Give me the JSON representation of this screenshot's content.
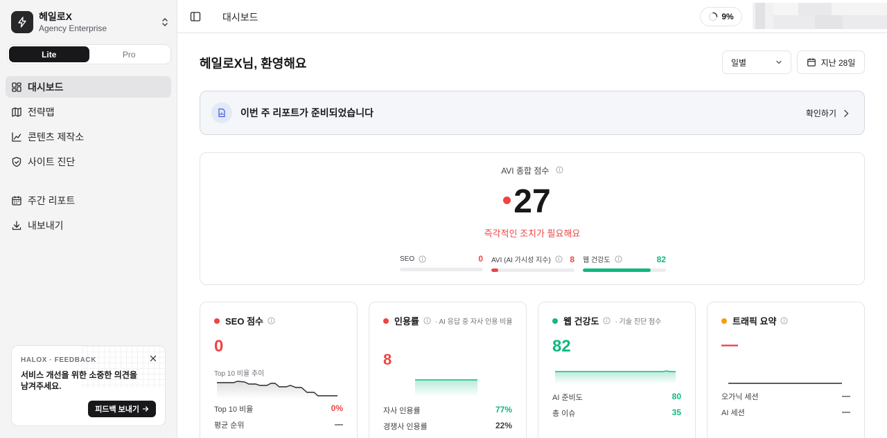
{
  "org": {
    "name": "헤일로X",
    "plan": "Agency Enterprise"
  },
  "plan_toggle": {
    "options": [
      "Lite",
      "Pro"
    ],
    "selected": "Lite"
  },
  "sidebar": {
    "items": [
      {
        "label": "대시보드",
        "icon": "dashboard-icon",
        "active": true
      },
      {
        "label": "전략맵",
        "icon": "map-icon"
      },
      {
        "label": "콘텐츠 제작소",
        "icon": "chart-icon"
      },
      {
        "label": "사이트 진단",
        "icon": "shield-icon"
      },
      {
        "label": "주간 리포트",
        "icon": "calendar-icon"
      },
      {
        "label": "내보내기",
        "icon": "download-icon"
      }
    ]
  },
  "feedback": {
    "eyebrow": "HALOX · FEEDBACK",
    "message": "서비스 개선을 위한 소중한 의견을 남겨주세요.",
    "button": "피드백 보내기"
  },
  "header": {
    "title": "대시보드",
    "progress": "9%"
  },
  "main": {
    "greeting": "헤일로X님, 환영해요",
    "period": "일별",
    "range": "지난 28일",
    "report_banner": {
      "text": "이번 주 리포트가 준비되었습니다",
      "cta": "확인하기"
    }
  },
  "avi": {
    "label": "AVI 종합 점수",
    "score": "27",
    "status": "즉각적인 조치가 필요해요",
    "metrics": [
      {
        "label": "SEO",
        "value": "0",
        "percent": 0,
        "color": "#ef4444"
      },
      {
        "label": "AVI (AI 가시성 지수)",
        "value": "8",
        "percent": 8,
        "color": "#ef4444"
      },
      {
        "label": "웹 건강도",
        "value": "82",
        "percent": 82,
        "color": "#10b981"
      }
    ]
  },
  "kpis": {
    "seo": {
      "title": "SEO 점수",
      "value": "0",
      "trend_label": "Top 10 비율 추이",
      "rows": [
        {
          "label": "Top 10 비율",
          "value": "0%"
        },
        {
          "label": "평균 순위",
          "value": "—"
        }
      ]
    },
    "citation": {
      "title": "인용률",
      "note": "· AI 응답 중 자사 인용 비율",
      "value": "8",
      "rows": [
        {
          "label": "자사 인용률",
          "value": "77%"
        },
        {
          "label": "경쟁사 인용률",
          "value": "22%"
        }
      ]
    },
    "web": {
      "title": "웹 건강도",
      "note": "· 기술 진단 점수",
      "value": "82",
      "rows": [
        {
          "label": "AI 준비도",
          "value": "80"
        },
        {
          "label": "총 이슈",
          "value": "35"
        }
      ]
    },
    "traffic": {
      "title": "트래픽 요약",
      "value": "—",
      "rows": [
        {
          "label": "오가닉 세션",
          "value": "—"
        },
        {
          "label": "AI 세션",
          "value": "—"
        }
      ]
    }
  },
  "colors": {
    "red": "#ef4444",
    "green": "#10b981",
    "amber": "#f59e0b",
    "dark": "#18181b"
  }
}
